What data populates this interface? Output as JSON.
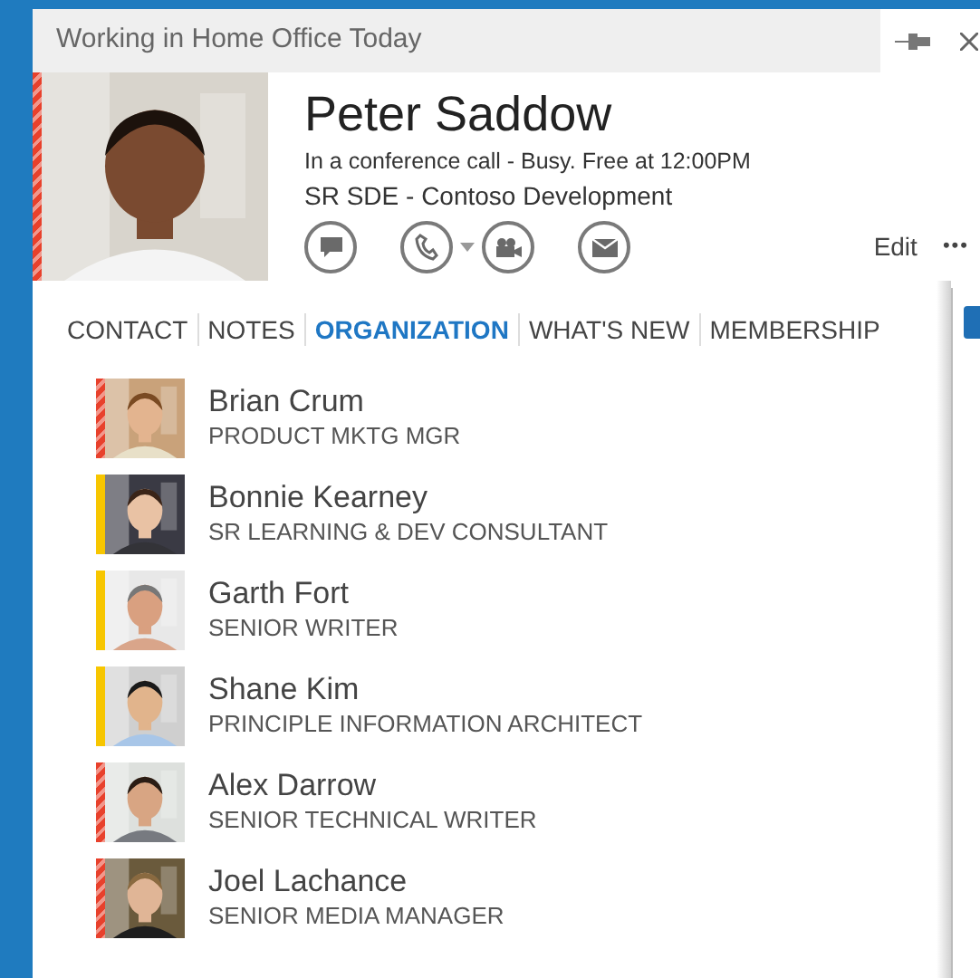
{
  "window": {
    "title": "Working in Home Office Today"
  },
  "contact": {
    "name": "Peter Saddow",
    "color": "#e8412c",
    "striped": true,
    "note": "In a conference call - Busy. Free at 12:00PM",
    "title": "SR SDE - Contoso Development"
  },
  "actions": {
    "edit": "Edit",
    "more": "•••"
  },
  "tabs": [
    {
      "label": "CONTACT",
      "selected": false
    },
    {
      "label": "NOTES",
      "selected": false
    },
    {
      "label": "ORGANIZATION",
      "selected": true
    },
    {
      "label": "WHAT'S NEW",
      "selected": false
    },
    {
      "label": "MEMBERSHIP",
      "selected": false
    }
  ],
  "people": [
    {
      "name": "Brian Crum",
      "title": "PRODUCT MKTG MGR",
      "color": "#e8412c",
      "striped": true
    },
    {
      "name": "Bonnie Kearney",
      "title": "SR LEARNING & DEV CONSULTANT",
      "color": "#f7c600",
      "striped": false
    },
    {
      "name": "Garth Fort",
      "title": "SENIOR WRITER",
      "color": "#f7c600",
      "striped": false
    },
    {
      "name": "Shane Kim",
      "title": "PRINCIPLE INFORMATION ARCHITECT",
      "color": "#f7c600",
      "striped": false
    },
    {
      "name": "Alex Darrow",
      "title": "SENIOR TECHNICAL WRITER",
      "color": "#e8412c",
      "striped": true
    },
    {
      "name": "Joel Lachance",
      "title": "SENIOR MEDIA MANAGER",
      "color": "#e8412c",
      "striped": true
    }
  ]
}
